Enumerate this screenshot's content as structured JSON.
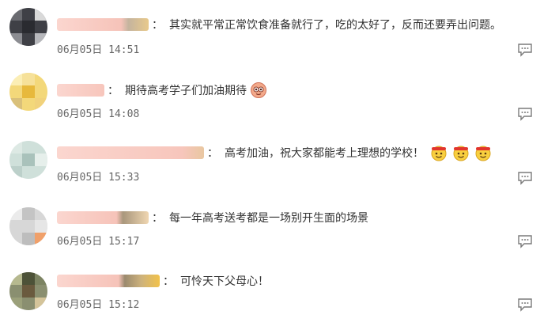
{
  "comments": [
    {
      "text": "其实就平常正常饮食准备就行了，吃的太好了，反而还要弄出问题。",
      "time": "06月05日 14:51",
      "reply_icon": "comment-reply-icon",
      "emoji": []
    },
    {
      "text": "期待高考学子们加油期待",
      "time": "06月05日 14:08",
      "reply_icon": "comment-reply-icon",
      "emoji": [
        "cheer-emoji"
      ]
    },
    {
      "text": "高考加油，祝大家都能考上理想的学校！",
      "time": "06月05日 15:33",
      "reply_icon": "comment-reply-icon",
      "emoji": [
        "fighting-emoji",
        "fighting-emoji",
        "fighting-emoji"
      ]
    },
    {
      "text": "每一年高考送考都是一场别开生面的场景",
      "time": "06月05日 15:17",
      "reply_icon": "comment-reply-icon",
      "emoji": []
    },
    {
      "text": "可怜天下父母心！",
      "time": "06月05日 15:12",
      "reply_icon": "comment-reply-icon",
      "emoji": []
    }
  ],
  "colon": "：",
  "colors": {
    "text": "#333333",
    "time": "#666666",
    "username_blur": "#f7c9c0",
    "icon": "#7a7a7a"
  }
}
